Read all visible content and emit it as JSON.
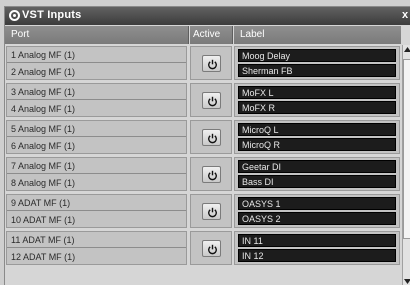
{
  "window": {
    "title": "VST Inputs",
    "close_glyph": "x"
  },
  "columns": {
    "port": "Port",
    "active": "Active",
    "label": "Label"
  },
  "rows": [
    {
      "port1": "1 Analog MF (1)",
      "port2": "2 Analog MF (1)",
      "label1": "Moog Delay",
      "label2": "Sherman FB"
    },
    {
      "port1": "3 Analog MF (1)",
      "port2": "4 Analog MF (1)",
      "label1": "MoFX L",
      "label2": "MoFX R"
    },
    {
      "port1": "5 Analog MF (1)",
      "port2": "6 Analog MF (1)",
      "label1": "MicroQ L",
      "label2": "MicroQ R"
    },
    {
      "port1": "7 Analog MF (1)",
      "port2": "8 Analog MF (1)",
      "label1": "Geetar DI",
      "label2": "Bass DI"
    },
    {
      "port1": "9 ADAT MF (1)",
      "port2": "10 ADAT MF (1)",
      "label1": "OASYS 1",
      "label2": "OASYS 2"
    },
    {
      "port1": "11 ADAT MF (1)",
      "port2": "12 ADAT MF (1)",
      "label1": "IN 11",
      "label2": "IN 12"
    }
  ],
  "icons": {
    "active_button": "power-icon",
    "logo": "vst-logo-icon",
    "close": "close-icon"
  }
}
